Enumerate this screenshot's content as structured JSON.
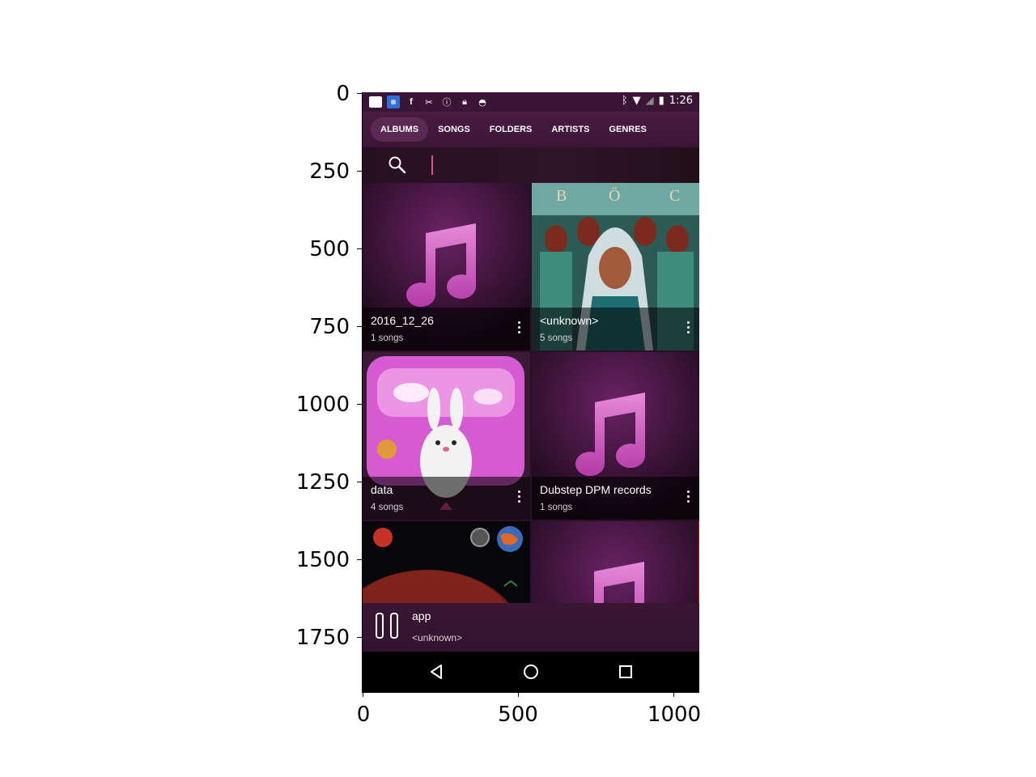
{
  "axes": {
    "y_ticks": [
      "0",
      "250",
      "500",
      "750",
      "1000",
      "1250",
      "1500",
      "1750"
    ],
    "x_ticks": [
      "0",
      "500",
      "1000"
    ]
  },
  "statusbar": {
    "time": "1:26",
    "left_icons": [
      "notification-icon",
      "app-notification-icon",
      "facebook-icon",
      "tools-icon",
      "info-icon",
      "lock-icon",
      "android-icon"
    ],
    "right_icons": [
      "bluetooth-icon",
      "wifi-icon",
      "signal-icon",
      "battery-icon"
    ]
  },
  "tabs": [
    {
      "label": "ALBUMS",
      "active": true
    },
    {
      "label": "SONGS",
      "active": false
    },
    {
      "label": "FOLDERS",
      "active": false
    },
    {
      "label": "ARTISTS",
      "active": false
    },
    {
      "label": "GENRES",
      "active": false
    }
  ],
  "search": {
    "placeholder": "",
    "value": ""
  },
  "albums": [
    {
      "title": "2016_12_26",
      "subtitle": "1 songs",
      "art": "music-note"
    },
    {
      "title": "<unknown>",
      "subtitle": "5 songs",
      "art": "blue-oyster-cult-cover"
    },
    {
      "title": "data",
      "subtitle": "4 songs",
      "art": "bunny-cover"
    },
    {
      "title": "Dubstep DPM records",
      "subtitle": "1 songs",
      "art": "music-note"
    },
    {
      "title": "",
      "subtitle": "",
      "art": "planet-cover"
    },
    {
      "title": "",
      "subtitle": "",
      "art": "music-note"
    }
  ],
  "player": {
    "title": "app",
    "subtitle": "<unknown>",
    "state": "playing"
  },
  "colors": {
    "accent": "#e0508a",
    "selection": "#e01010",
    "tile_purple": "#5b1c55"
  }
}
